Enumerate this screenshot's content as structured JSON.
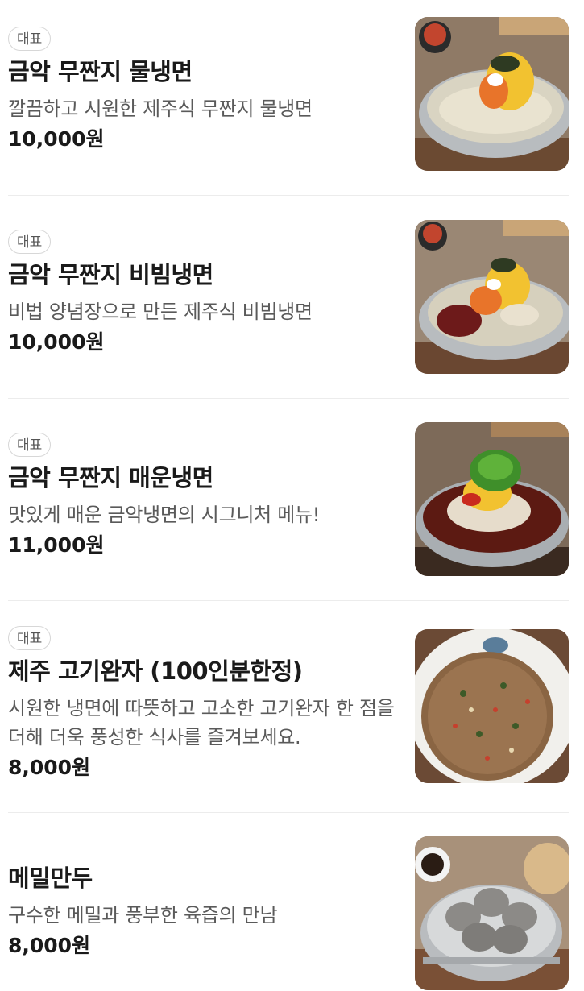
{
  "menu": {
    "items": [
      {
        "badge": "대표",
        "name": "금악 무짠지 물냉면",
        "desc": "깔끔하고 시원한 제주식 무짠지 물냉면",
        "price": "10,000원",
        "image_icon": "mul-naengmyeon-photo"
      },
      {
        "badge": "대표",
        "name": "금악 무짠지 비빔냉면",
        "desc": "비법 양념장으로 만든 제주식 비빔냉면",
        "price": "10,000원",
        "image_icon": "bibim-naengmyeon-photo"
      },
      {
        "badge": "대표",
        "name": "금악 무짠지 매운냉면",
        "desc": "맛있게 매운 금악냉면의 시그니처 메뉴!",
        "price": "11,000원",
        "image_icon": "spicy-naengmyeon-photo"
      },
      {
        "badge": "대표",
        "name": "제주 고기완자 (100인분한정)",
        "desc": "시원한 냉면에 따뜻하고 고소한 고기완자 한 점을 더해 더욱 풍성한 식사를 즐겨보세요.",
        "price": "8,000원",
        "image_icon": "meat-pancake-photo"
      },
      {
        "name": "메밀만두",
        "desc": "구수한 메밀과 풍부한 육즙의 만남",
        "price": "8,000원",
        "image_icon": "buckwheat-dumpling-photo"
      }
    ]
  },
  "colors": {
    "text_primary": "#1a1a1a",
    "text_secondary": "#5a5a5a",
    "badge_border": "#d7d7d7",
    "divider": "#ececec"
  }
}
